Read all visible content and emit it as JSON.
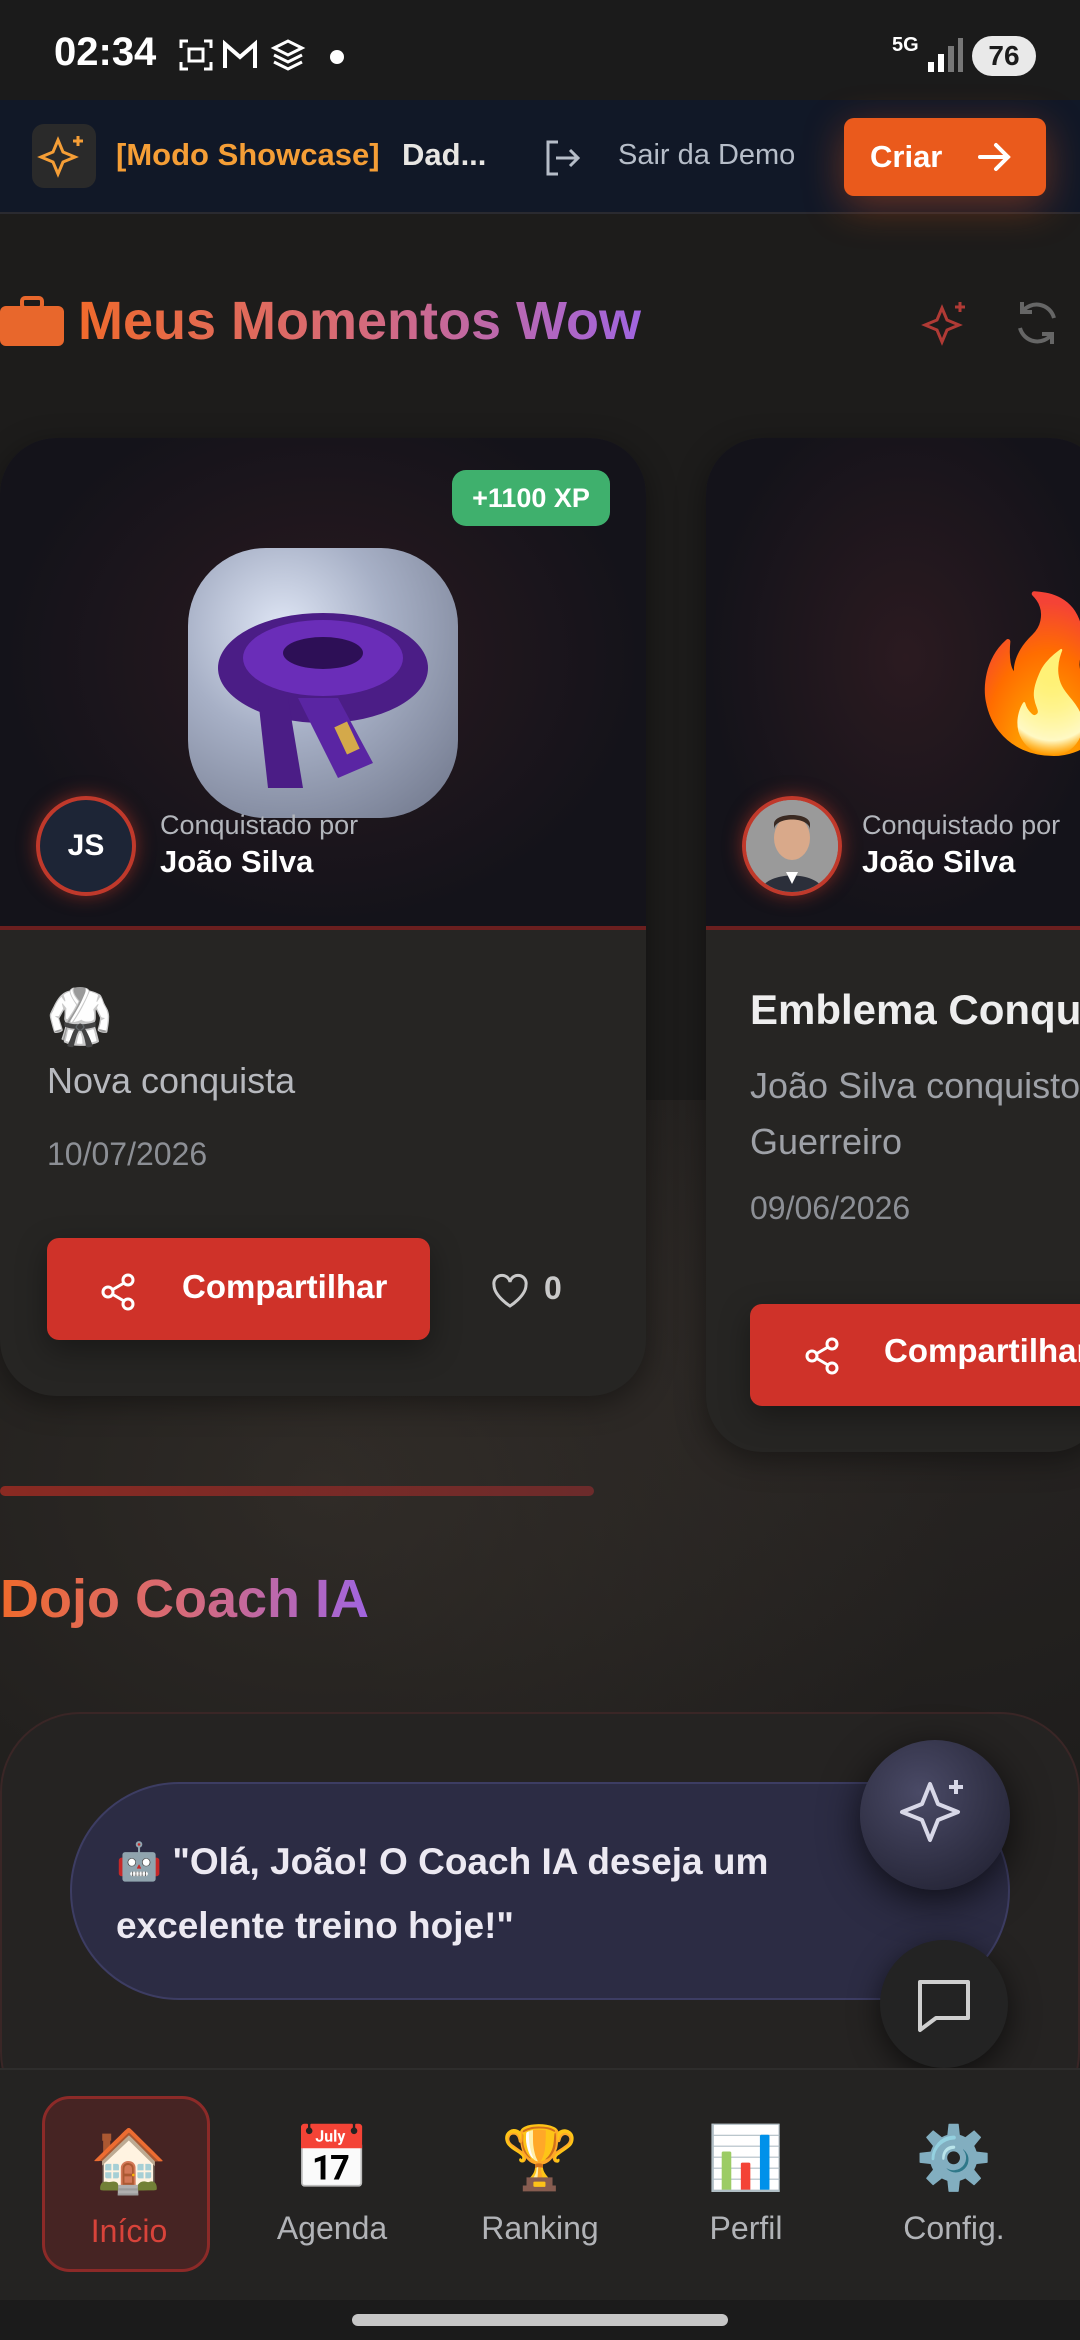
{
  "status_bar": {
    "time": "02:34",
    "network": "5G",
    "battery": "76"
  },
  "demo_banner": {
    "mode_label": "[Modo Showcase]",
    "data_label": "Dad...",
    "exit_label": "Sair da Demo",
    "create_label": "Criar"
  },
  "moments": {
    "title": "Meus Momentos Wow",
    "cards": [
      {
        "xp_badge": "+1100 XP",
        "avatar_initials": "JS",
        "achieved_by_label": "Conquistado por",
        "achieved_by_name": "João Silva",
        "emoji": "🥋",
        "description": "Nova conquista",
        "date": "10/07/2026",
        "share_label": "Compartilhar",
        "likes": "0"
      },
      {
        "achieved_by_label": "Conquistado por",
        "achieved_by_name": "João Silva",
        "hero_emoji": "🔥",
        "title": "Emblema Conquistado",
        "description": "João Silva conquistou o emblema Guerreiro",
        "date": "09/06/2026",
        "share_label": "Compartilhar"
      }
    ]
  },
  "coach": {
    "title": "Dojo Coach IA",
    "message": "🤖 \"Olá, João! O Coach IA deseja um excelente treino hoje!\""
  },
  "nav": {
    "items": [
      {
        "label": "Início",
        "icon": "🏠"
      },
      {
        "label": "Agenda",
        "icon": "📅"
      },
      {
        "label": "Ranking",
        "icon": "🏆"
      },
      {
        "label": "Perfil",
        "icon": "📊"
      },
      {
        "label": "Config.",
        "icon": "⚙️"
      }
    ]
  },
  "colors": {
    "accent_orange": "#ea5a1c",
    "share_red": "#cf3229",
    "xp_green": "#3fb06d"
  }
}
